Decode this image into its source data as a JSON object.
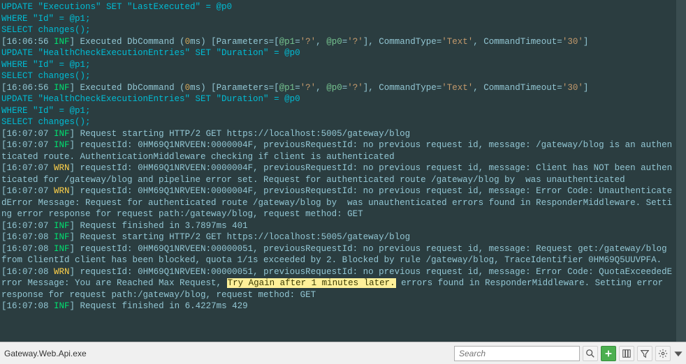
{
  "log_lines": [
    [
      {
        "cls": "c-sql",
        "t": "UPDATE \"Executions\" SET \"LastExecuted\" = @p0"
      }
    ],
    [
      {
        "cls": "c-sql",
        "t": "WHERE \"Id\" = @p1;"
      }
    ],
    [
      {
        "cls": "c-sql",
        "t": "SELECT changes();"
      }
    ],
    [
      {
        "cls": "c-px",
        "t": "["
      },
      {
        "cls": "c-px",
        "t": "16:06:56 "
      },
      {
        "cls": "c-info",
        "t": "INF"
      },
      {
        "cls": "c-px",
        "t": "] Executed DbCommand ("
      },
      {
        "cls": "c-num",
        "t": "0"
      },
      {
        "cls": "c-px",
        "t": "ms) [Parameters=["
      },
      {
        "cls": "c-param",
        "t": "@p1"
      },
      {
        "cls": "c-px",
        "t": "="
      },
      {
        "cls": "c-quote",
        "t": "'?'"
      },
      {
        "cls": "c-px",
        "t": ", "
      },
      {
        "cls": "c-param",
        "t": "@p0"
      },
      {
        "cls": "c-px",
        "t": "="
      },
      {
        "cls": "c-quote",
        "t": "'?'"
      },
      {
        "cls": "c-px",
        "t": "], CommandType="
      },
      {
        "cls": "c-quote",
        "t": "'Text'"
      },
      {
        "cls": "c-px",
        "t": ", CommandTimeout="
      },
      {
        "cls": "c-quote",
        "t": "'30'"
      },
      {
        "cls": "c-px",
        "t": "]"
      }
    ],
    [
      {
        "cls": "c-sql",
        "t": "UPDATE \"HealthCheckExecutionEntries\" SET \"Duration\" = @p0"
      }
    ],
    [
      {
        "cls": "c-sql",
        "t": "WHERE \"Id\" = @p1;"
      }
    ],
    [
      {
        "cls": "c-sql",
        "t": "SELECT changes();"
      }
    ],
    [
      {
        "cls": "c-px",
        "t": "["
      },
      {
        "cls": "c-px",
        "t": "16:06:56 "
      },
      {
        "cls": "c-info",
        "t": "INF"
      },
      {
        "cls": "c-px",
        "t": "] Executed DbCommand ("
      },
      {
        "cls": "c-num",
        "t": "0"
      },
      {
        "cls": "c-px",
        "t": "ms) [Parameters=["
      },
      {
        "cls": "c-param",
        "t": "@p1"
      },
      {
        "cls": "c-px",
        "t": "="
      },
      {
        "cls": "c-quote",
        "t": "'?'"
      },
      {
        "cls": "c-px",
        "t": ", "
      },
      {
        "cls": "c-param",
        "t": "@p0"
      },
      {
        "cls": "c-px",
        "t": "="
      },
      {
        "cls": "c-quote",
        "t": "'?'"
      },
      {
        "cls": "c-px",
        "t": "], CommandType="
      },
      {
        "cls": "c-quote",
        "t": "'Text'"
      },
      {
        "cls": "c-px",
        "t": ", CommandTimeout="
      },
      {
        "cls": "c-quote",
        "t": "'30'"
      },
      {
        "cls": "c-px",
        "t": "]"
      }
    ],
    [
      {
        "cls": "c-sql",
        "t": "UPDATE \"HealthCheckExecutionEntries\" SET \"Duration\" = @p0"
      }
    ],
    [
      {
        "cls": "c-sql",
        "t": "WHERE \"Id\" = @p1;"
      }
    ],
    [
      {
        "cls": "c-sql",
        "t": "SELECT changes();"
      }
    ],
    [
      {
        "cls": "c-px",
        "t": "["
      },
      {
        "cls": "c-px",
        "t": "16:07:07 "
      },
      {
        "cls": "c-info",
        "t": "INF"
      },
      {
        "cls": "c-px",
        "t": "] "
      },
      {
        "cls": "c-px",
        "t": "Request starting HTTP/2 GET https://localhost:5005/gateway/blog"
      }
    ],
    [
      {
        "cls": "c-px",
        "t": "["
      },
      {
        "cls": "c-px",
        "t": "16:07:07 "
      },
      {
        "cls": "c-info",
        "t": "INF"
      },
      {
        "cls": "c-px",
        "t": "] requestId: 0HM69Q1NRVEEN:0000004F, previousRequestId: no previous request id, message: /gateway/blog is an authenticated route. AuthenticationMiddleware checking if client is authenticated"
      }
    ],
    [
      {
        "cls": "c-px",
        "t": "["
      },
      {
        "cls": "c-px",
        "t": "16:07:07 "
      },
      {
        "cls": "c-warn",
        "t": "WRN"
      },
      {
        "cls": "c-px",
        "t": "] requestId: 0HM69Q1NRVEEN:0000004F, previousRequestId: no previous request id, message: Client has NOT been authenticated for /gateway/blog and pipeline error set. Request for authenticated route /gateway/blog by  was unauthenticated"
      }
    ],
    [
      {
        "cls": "c-px",
        "t": "["
      },
      {
        "cls": "c-px",
        "t": "16:07:07 "
      },
      {
        "cls": "c-warn",
        "t": "WRN"
      },
      {
        "cls": "c-px",
        "t": "] requestId: 0HM69Q1NRVEEN:0000004F, previousRequestId: no previous request id, message: Error Code: UnauthenticatedError Message: Request for authenticated route /gateway/blog by  was unauthenticated errors found in ResponderMiddleware. Setting error response for request path:/gateway/blog, request method: GET"
      }
    ],
    [
      {
        "cls": "c-px",
        "t": "["
      },
      {
        "cls": "c-px",
        "t": "16:07:07 "
      },
      {
        "cls": "c-info",
        "t": "INF"
      },
      {
        "cls": "c-px",
        "t": "] Request finished in 3.7897ms 401"
      }
    ],
    [
      {
        "cls": "c-px",
        "t": "["
      },
      {
        "cls": "c-px",
        "t": "16:07:08 "
      },
      {
        "cls": "c-info",
        "t": "INF"
      },
      {
        "cls": "c-px",
        "t": "] Request starting HTTP/2 GET https://localhost:5005/gateway/blog"
      }
    ],
    [
      {
        "cls": "c-px",
        "t": "["
      },
      {
        "cls": "c-px",
        "t": "16:07:08 "
      },
      {
        "cls": "c-info",
        "t": "INF"
      },
      {
        "cls": "c-px",
        "t": "] requestId: 0HM69Q1NRVEEN:00000051, previousRequestId: no previous request id, message: Request get:/gateway/blog from ClientId client has been blocked, quota 1/1s exceeded by 2. Blocked by rule /gateway/blog, TraceIdentifier 0HM69Q5UUVPFA."
      }
    ],
    [
      {
        "cls": "c-px",
        "t": "["
      },
      {
        "cls": "c-px",
        "t": "16:07:08 "
      },
      {
        "cls": "c-warn",
        "t": "WRN"
      },
      {
        "cls": "c-px",
        "t": "] requestId: 0HM69Q1NRVEEN:00000051, previousRequestId: no previous request id, message: Error Code: QuotaExceededError Message: You are Reached Max Request, "
      },
      {
        "cls": "hl",
        "t": "Try Again after 1 minutes later."
      },
      {
        "cls": "c-px",
        "t": " errors found in ResponderMiddleware. Setting error response for request path:/gateway/blog, request method: GET"
      }
    ],
    [
      {
        "cls": "c-px",
        "t": "["
      },
      {
        "cls": "c-px",
        "t": "16:07:08 "
      },
      {
        "cls": "c-info",
        "t": "INF"
      },
      {
        "cls": "c-px",
        "t": "] Request finished in 6.4227ms 429"
      }
    ]
  ],
  "status": {
    "process": "Gateway.Web.Api.exe",
    "search_placeholder": "Search"
  },
  "icons": {
    "search": "search-icon",
    "add": "add-icon",
    "columns": "columns-icon",
    "filter": "filter-icon",
    "settings": "settings-icon"
  }
}
